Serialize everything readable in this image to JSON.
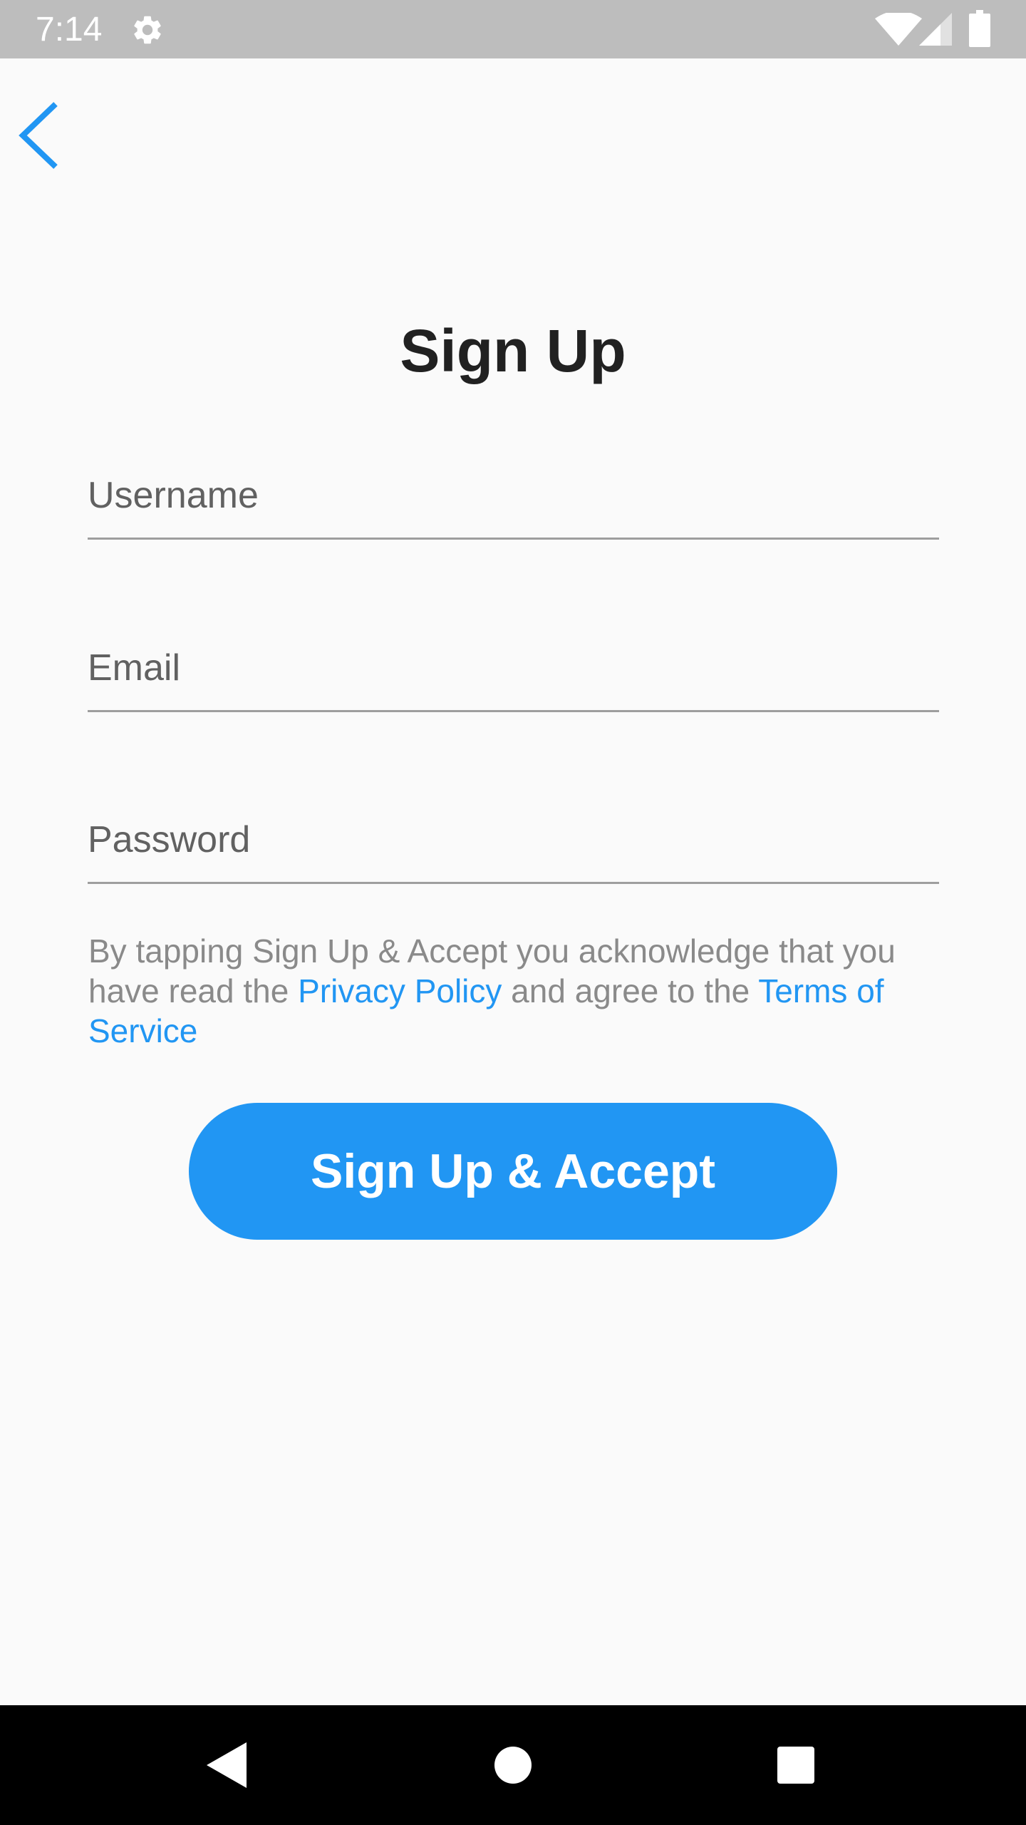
{
  "status_bar": {
    "time": "7:14",
    "icons": [
      "settings-icon",
      "wifi-icon",
      "signal-icon",
      "battery-icon"
    ]
  },
  "header": {
    "back_icon": "chevron-left-icon"
  },
  "page": {
    "title": "Sign Up"
  },
  "form": {
    "username": {
      "placeholder": "Username",
      "value": ""
    },
    "email": {
      "placeholder": "Email",
      "value": ""
    },
    "password": {
      "placeholder": "Password",
      "value": ""
    }
  },
  "legal": {
    "text_before": "By tapping Sign Up & Accept you acknowledge that you have read the ",
    "privacy_link": "Privacy Policy",
    "text_middle": " and agree to the ",
    "terms_link": "Terms of Service"
  },
  "actions": {
    "primary_label": "Sign Up & Accept"
  },
  "nav_bar": {
    "icons": [
      "nav-back-icon",
      "nav-home-icon",
      "nav-recents-icon"
    ]
  },
  "colors": {
    "accent": "#2196f3",
    "status_bar": "#bdbdbd",
    "background": "#fafafa",
    "title": "#212121",
    "hint": "#616161",
    "legal": "#8a8a8a",
    "nav_bar": "#000000"
  }
}
